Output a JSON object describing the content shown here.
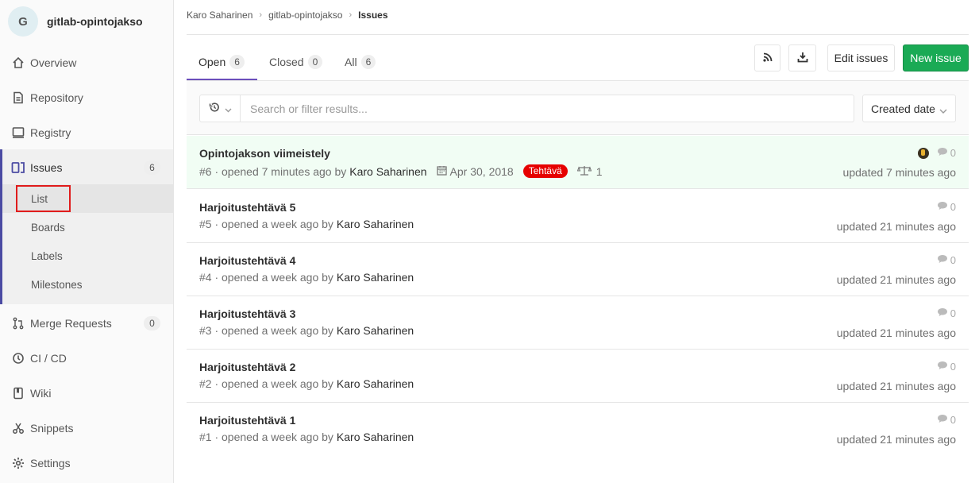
{
  "project": {
    "avatar_letter": "G",
    "name": "gitlab-opintojakso"
  },
  "sidebar": {
    "items": [
      {
        "label": "Overview",
        "icon": "home-icon"
      },
      {
        "label": "Repository",
        "icon": "file-icon"
      },
      {
        "label": "Registry",
        "icon": "monitor-icon"
      },
      {
        "label": "Issues",
        "icon": "issues-icon",
        "count": "6"
      },
      {
        "label": "Merge Requests",
        "icon": "merge-request-icon",
        "count": "0"
      },
      {
        "label": "CI / CD",
        "icon": "rocket-icon"
      },
      {
        "label": "Wiki",
        "icon": "book-icon"
      },
      {
        "label": "Snippets",
        "icon": "scissors-icon"
      },
      {
        "label": "Settings",
        "icon": "gear-icon"
      }
    ],
    "issues_sub": [
      "List",
      "Boards",
      "Labels",
      "Milestones"
    ]
  },
  "breadcrumb": [
    "Karo Saharinen",
    "gitlab-opintojakso",
    "Issues"
  ],
  "tabs": [
    {
      "label": "Open",
      "count": "6"
    },
    {
      "label": "Closed",
      "count": "0"
    },
    {
      "label": "All",
      "count": "6"
    }
  ],
  "buttons": {
    "edit": "Edit issues",
    "new": "New issue"
  },
  "filter": {
    "placeholder": "Search or filter results...",
    "sort": "Created date"
  },
  "issues": [
    {
      "title": "Opintojakson viimeistely",
      "ref": "#6 · opened 7 minutes ago by",
      "author": "Karo Saharinen",
      "due": "Apr 30, 2018",
      "label": "Tehtävä",
      "weight": "1",
      "comments": "0",
      "updated": "updated 7 minutes ago"
    },
    {
      "title": "Harjoitustehtävä 5",
      "ref": "#5 · opened a week ago by",
      "author": "Karo Saharinen",
      "comments": "0",
      "updated": "updated 21 minutes ago"
    },
    {
      "title": "Harjoitustehtävä 4",
      "ref": "#4 · opened a week ago by",
      "author": "Karo Saharinen",
      "comments": "0",
      "updated": "updated 21 minutes ago"
    },
    {
      "title": "Harjoitustehtävä 3",
      "ref": "#3 · opened a week ago by",
      "author": "Karo Saharinen",
      "comments": "0",
      "updated": "updated 21 minutes ago"
    },
    {
      "title": "Harjoitustehtävä 2",
      "ref": "#2 · opened a week ago by",
      "author": "Karo Saharinen",
      "comments": "0",
      "updated": "updated 21 minutes ago"
    },
    {
      "title": "Harjoitustehtävä 1",
      "ref": "#1 · opened a week ago by",
      "author": "Karo Saharinen",
      "comments": "0",
      "updated": "updated 21 minutes ago"
    }
  ],
  "colors": {
    "accent": "#6b4fbb",
    "sidebar_active_bar": "#4b4ba3",
    "new_issue": "#1aaa55",
    "label_tehtava": "#e60000",
    "highlight_row": "#f1fdf4"
  }
}
